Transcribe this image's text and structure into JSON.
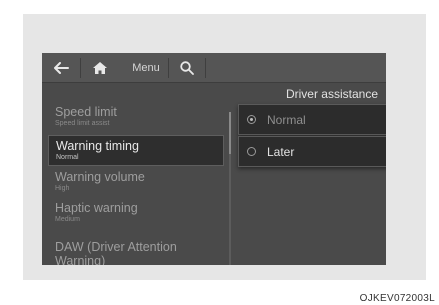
{
  "topbar": {
    "back_icon": "back-arrow-icon",
    "home_icon": "home-icon",
    "menu_label": "Menu",
    "search_icon": "search-icon"
  },
  "panel": {
    "title": "Driver assistance"
  },
  "settings_list": [
    {
      "title": "Speed limit",
      "subtitle": "Speed limit assist",
      "selected": false
    },
    {
      "title": "Warning timing",
      "subtitle": "Normal",
      "selected": true
    },
    {
      "title": "Warning volume",
      "subtitle": "High",
      "selected": false
    },
    {
      "title": "Haptic warning",
      "subtitle": "Medium",
      "selected": false
    },
    {
      "title": "DAW (Driver Attention Warning)",
      "subtitle": "",
      "selected": false
    }
  ],
  "options": [
    {
      "label": "Normal",
      "checked": true
    },
    {
      "label": "Later",
      "checked": false
    }
  ],
  "image_code": "OJKEV072003L",
  "colors": {
    "screen_bg": "#4a4a4a",
    "selected_bg": "#2e2e2e",
    "frame_bg": "#e6e6e6"
  }
}
